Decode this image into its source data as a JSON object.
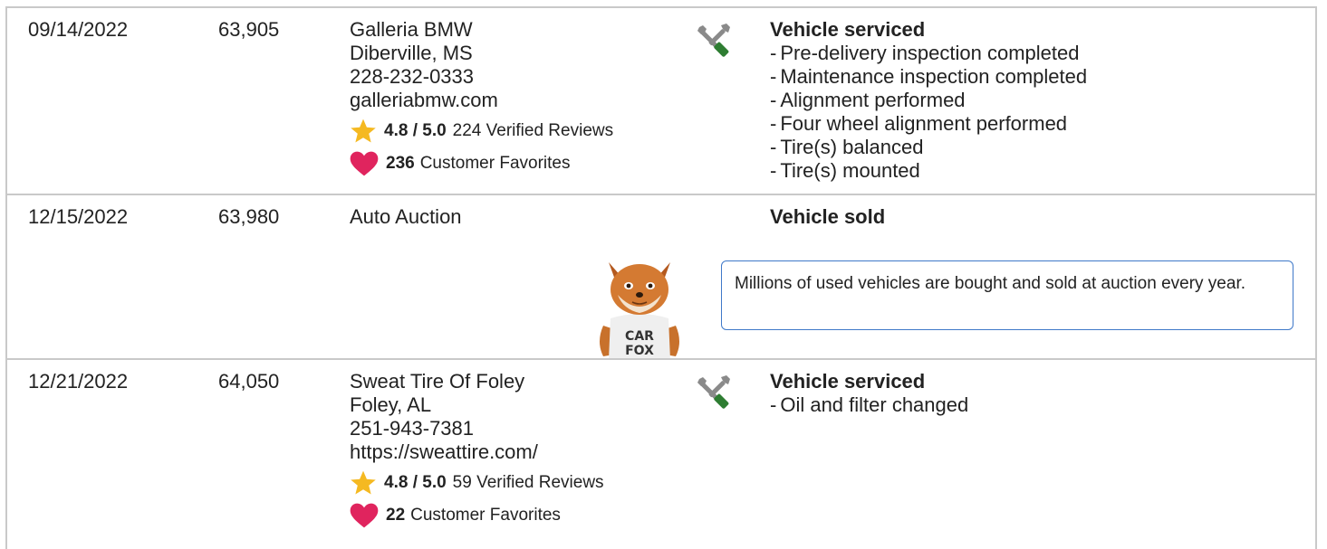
{
  "records": [
    {
      "date": "09/14/2022",
      "mileage": "63,905",
      "source": {
        "name": "Galleria BMW",
        "location": "Diberville, MS",
        "phone": "228-232-0333",
        "website": "galleriabmw.com",
        "rating": "4.8 / 5.0",
        "reviews": "224 Verified Reviews",
        "favorites_count": "236",
        "favorites_label": "Customer Favorites"
      },
      "icon": "service-wrench-screwdriver-icon",
      "title": "Vehicle serviced",
      "items": [
        "Pre-delivery inspection completed",
        "Maintenance inspection completed",
        "Alignment performed",
        "Four wheel alignment performed",
        "Tire(s) balanced",
        "Tire(s) mounted"
      ]
    },
    {
      "date": "12/15/2022",
      "mileage": "63,980",
      "source": {
        "name": "Auto Auction"
      },
      "title": "Vehicle sold",
      "callout": "Millions of used vehicles are bought and sold at auction every year.",
      "mascot_shirt_line1": "CAR",
      "mascot_shirt_line2": "FOX"
    },
    {
      "date": "12/21/2022",
      "mileage": "64,050",
      "source": {
        "name": "Sweat Tire Of Foley",
        "location": "Foley, AL",
        "phone": "251-943-7381",
        "website": "https://sweattire.com/",
        "rating": "4.8 / 5.0",
        "reviews": "59 Verified Reviews",
        "favorites_count": "22",
        "favorites_label": "Customer Favorites"
      },
      "icon": "service-wrench-screwdriver-icon",
      "title": "Vehicle serviced",
      "items": [
        "Oil and filter changed"
      ]
    }
  ],
  "dash": "-",
  "colors": {
    "star": "#f5b921",
    "heart": "#e0245e",
    "callout_border": "#3f79c9",
    "divider": "#c9c9c9",
    "service_green": "#2e7d32"
  }
}
